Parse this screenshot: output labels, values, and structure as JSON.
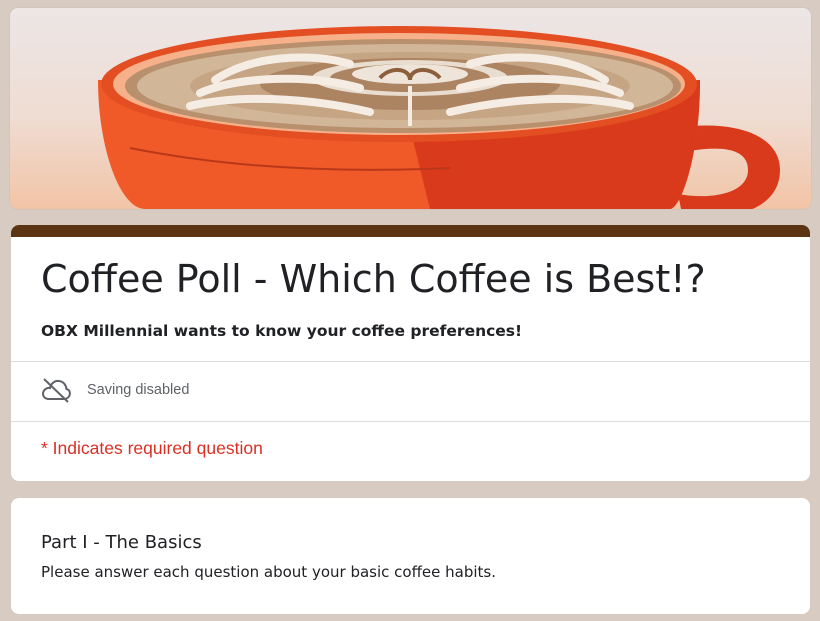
{
  "form": {
    "title": "Coffee Poll - Which Coffee is Best!?",
    "description": "OBX Millennial wants to know your coffee preferences!",
    "saving_status": "Saving disabled",
    "saving_icon": "cloud-off-icon",
    "required_note": "* Indicates required question"
  },
  "section": {
    "title": "Part I - The Basics",
    "description": "Please answer each question about your basic coffee habits."
  },
  "colors": {
    "page_background": "#d8ccc2",
    "accent_bar": "#5b3414",
    "required_text": "#d93025",
    "cup_orange": "#f05a28"
  }
}
